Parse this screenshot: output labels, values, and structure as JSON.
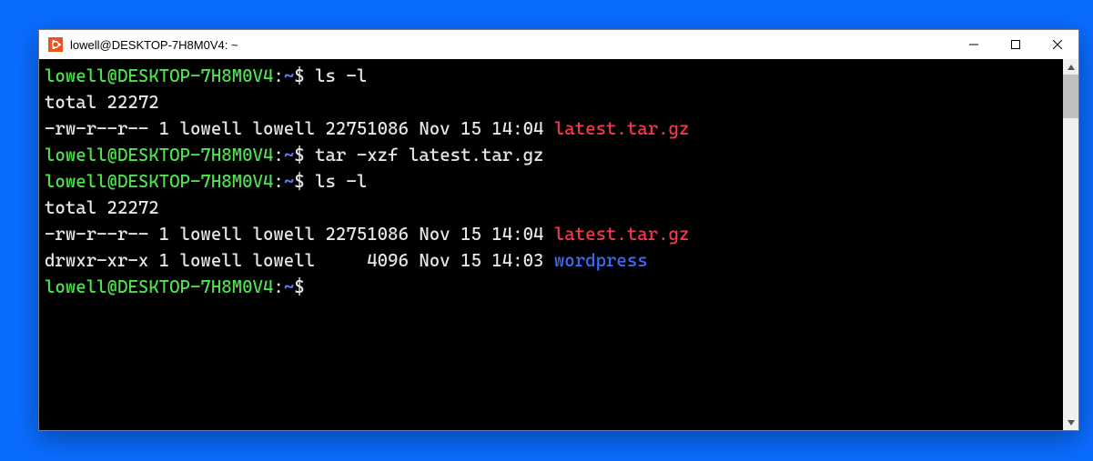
{
  "window": {
    "title": "lowell@DESKTOP-7H8M0V4: ~"
  },
  "prompt": {
    "user_host": "lowell@DESKTOP-7H8M0V4",
    "colon": ":",
    "path": "~",
    "symbol": "$"
  },
  "lines": [
    {
      "type": "prompt",
      "cmd": "ls -l"
    },
    {
      "type": "plain",
      "text": "total 22272"
    },
    {
      "type": "ls",
      "perms": "-rw-r--r-- 1 lowell lowell 22751086 Nov 15 14:04 ",
      "name": "latest.tar.gz",
      "color": "red"
    },
    {
      "type": "prompt",
      "cmd": "tar -xzf latest.tar.gz"
    },
    {
      "type": "prompt",
      "cmd": "ls -l"
    },
    {
      "type": "plain",
      "text": "total 22272"
    },
    {
      "type": "ls",
      "perms": "-rw-r--r-- 1 lowell lowell 22751086 Nov 15 14:04 ",
      "name": "latest.tar.gz",
      "color": "red"
    },
    {
      "type": "ls",
      "perms": "drwxr-xr-x 1 lowell lowell     4096 Nov 15 14:03 ",
      "name": "wordpress",
      "color": "blue"
    },
    {
      "type": "prompt",
      "cmd": ""
    }
  ]
}
